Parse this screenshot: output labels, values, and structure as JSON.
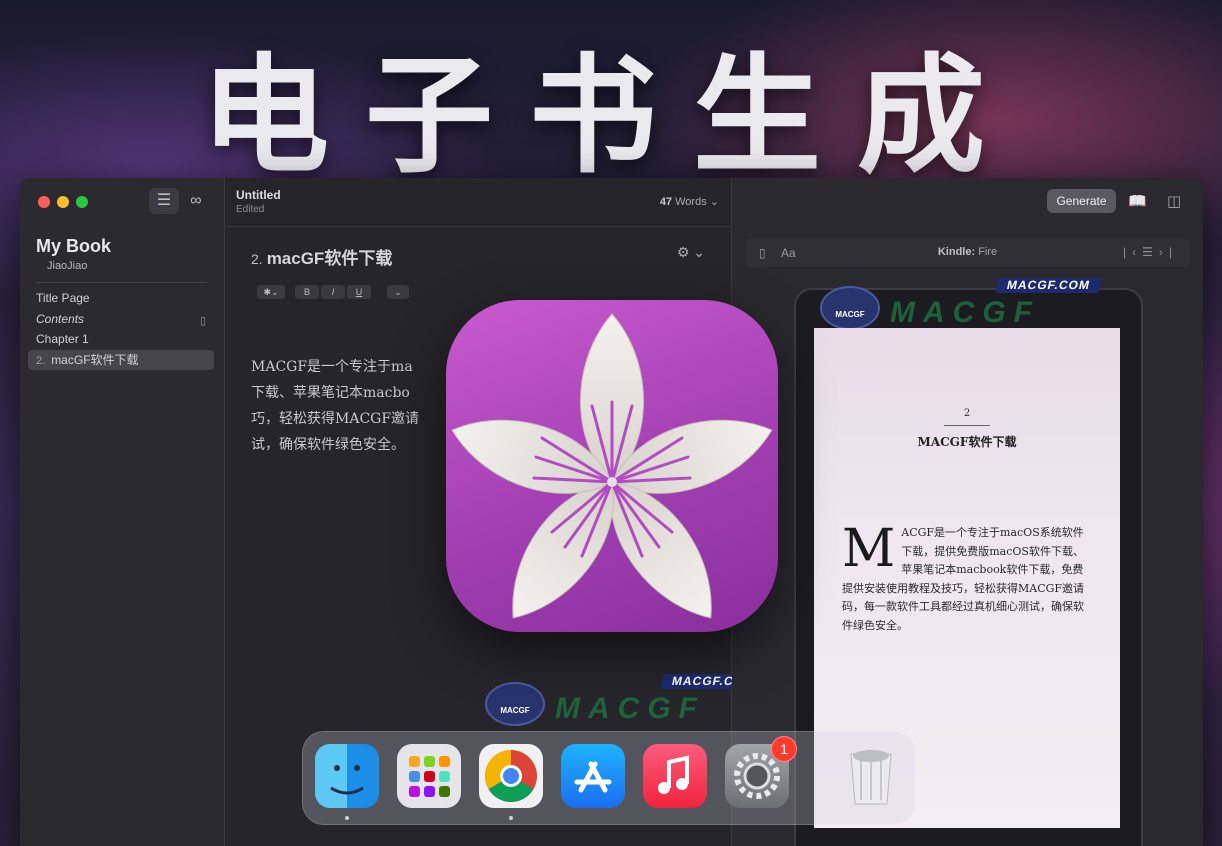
{
  "hero": {
    "title": "电子书生成"
  },
  "window": {
    "sidebar": {
      "book_title": "My Book",
      "author": "JiaoJiao",
      "items": [
        {
          "label": "Title Page",
          "italic": false
        },
        {
          "label": "Contents",
          "italic": true
        },
        {
          "label": "Chapter 1",
          "italic": false
        },
        {
          "label": "macGF软件下载",
          "number": "2."
        }
      ]
    },
    "editor": {
      "doc_name": "Untitled",
      "doc_status": "Edited",
      "word_count": "47",
      "word_label": "Words",
      "chapter_number": "2.",
      "chapter_title": "macGF软件下载",
      "format_buttons": [
        "B",
        "I",
        "U"
      ],
      "paragraph_lines": [
        "MACGF是一个专注于ma",
        "下载、苹果笔记本macbo",
        "巧，轻松获得MACGF邀请",
        "试，确保软件绿色安全。"
      ]
    },
    "preview": {
      "generate_label": "Generate",
      "font_label": "Aa",
      "device_prefix": "Kindle:",
      "device_name": "Fire",
      "page_number": "2",
      "page_title": "MACGF软件下载",
      "dropcap": "M",
      "body": "ACGF是一个专注于macOS系统软件下载，提供免费版macOS软件下载、苹果笔记本macbook软件下载，免费提供安装使用教程及技巧，轻松获得MACGF邀请码，每一款软件工具都经过真机细心测试，确保软件绿色安全。"
    }
  },
  "watermark": {
    "domain": "MACGF.COM",
    "brand": "MACGF",
    "face_label": "MACGF"
  },
  "dock": {
    "apps": [
      "Finder",
      "Launchpad",
      "Chrome",
      "App Store",
      "Music",
      "System Settings",
      "Trash"
    ],
    "settings_badge": "1"
  },
  "colors": {
    "accent_purple": "#a23fb2",
    "badge_red": "#ff3b30"
  }
}
